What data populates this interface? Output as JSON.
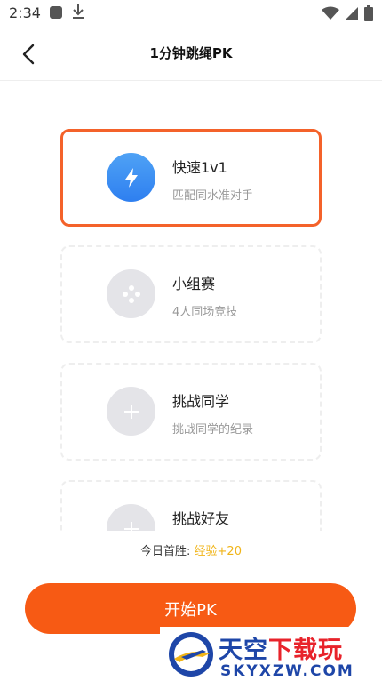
{
  "status_bar": {
    "time": "2:34",
    "icons": [
      "app-notification-icon",
      "download-icon",
      "wifi-icon",
      "signal-icon",
      "battery-icon"
    ]
  },
  "header": {
    "back_icon": "chevron-left-icon",
    "title": "1分钟跳绳PK"
  },
  "modes": [
    {
      "title": "快速1v1",
      "subtitle": "匹配同水准对手",
      "icon": "lightning-icon",
      "selected": true
    },
    {
      "title": "小组赛",
      "subtitle": "4人同场竞技",
      "icon": "group-dots-icon",
      "selected": false
    },
    {
      "title": "挑战同学",
      "subtitle": "挑战同学的纪录",
      "icon": "plus-icon",
      "selected": false
    },
    {
      "title": "挑战好友",
      "subtitle": "",
      "icon": "plus-icon",
      "selected": false
    }
  ],
  "reward": {
    "label": "今日首胜: ",
    "value": "经验+20"
  },
  "start_button": {
    "label": "开始PK"
  },
  "watermark": {
    "title_blue": "天空",
    "title_red": "下载玩",
    "url": "SKYXZW.COM"
  },
  "colors": {
    "accent": "#f75a14",
    "selected_border": "#f4622a",
    "reward": "#f0b418",
    "icon_blue": "#3a8cf2"
  }
}
